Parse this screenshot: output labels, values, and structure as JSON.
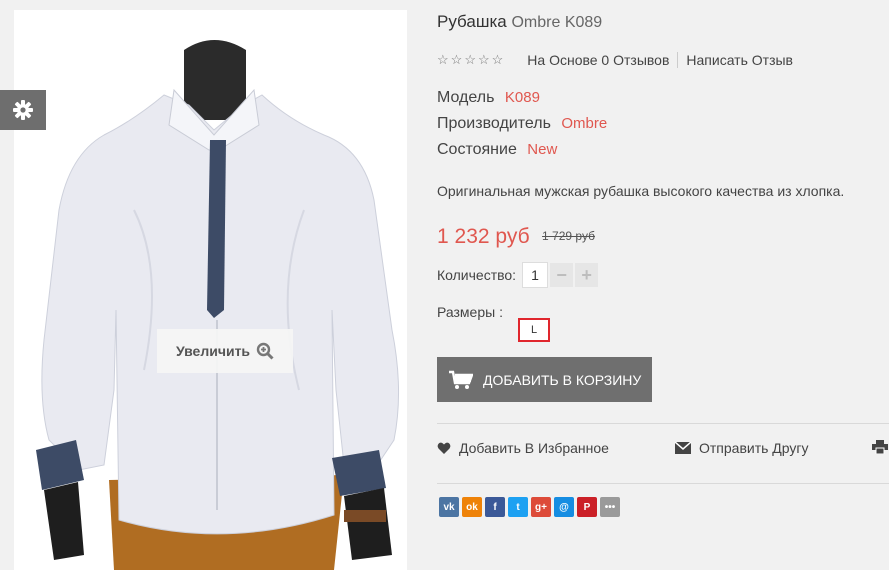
{
  "product": {
    "title_main": "Рубашка",
    "title_suffix": "Ombre K089",
    "rating": {
      "stars_filled": 0,
      "stars_total": 5,
      "reviews_text": "На Основе 0 Отзывов",
      "write_review": "Написать Отзыв"
    },
    "specs": [
      {
        "label": "Модель",
        "value": "K089"
      },
      {
        "label": "Производитель",
        "value": "Ombre"
      },
      {
        "label": "Состояние",
        "value": "New"
      }
    ],
    "description": "Оригинальная мужская рубашка высокого качества из хлопка.",
    "price_new": "1 232 руб",
    "price_old": "1 729 руб",
    "quantity_label": "Количество:",
    "quantity_value": "1",
    "sizes_label": "Размеры :",
    "size_options": [
      "L"
    ],
    "add_to_cart": "Добавить в корзину"
  },
  "gallery": {
    "zoom_label": "Увеличить"
  },
  "actions": {
    "wishlist": "Добавить В Избранное",
    "send_friend": "Отправить Другу"
  },
  "share_buttons": [
    {
      "icon": "vk-icon",
      "glyph": "vk",
      "color": "#4c75a3"
    },
    {
      "icon": "odnoklassniki-icon",
      "glyph": "ok",
      "color": "#ee8208"
    },
    {
      "icon": "facebook-icon",
      "glyph": "f",
      "color": "#3b5998"
    },
    {
      "icon": "twitter-icon",
      "glyph": "t",
      "color": "#1da1f2"
    },
    {
      "icon": "google-plus-icon",
      "glyph": "g+",
      "color": "#dd4b39"
    },
    {
      "icon": "mailru-icon",
      "glyph": "@",
      "color": "#168de2"
    },
    {
      "icon": "pinterest-icon",
      "glyph": "P",
      "color": "#cb2027"
    },
    {
      "icon": "more-icon",
      "glyph": "•••",
      "color": "#9a9a9a"
    }
  ],
  "colors": {
    "accent": "#e0574f",
    "button": "#6f6f6f",
    "size_border": "#e0262d"
  }
}
